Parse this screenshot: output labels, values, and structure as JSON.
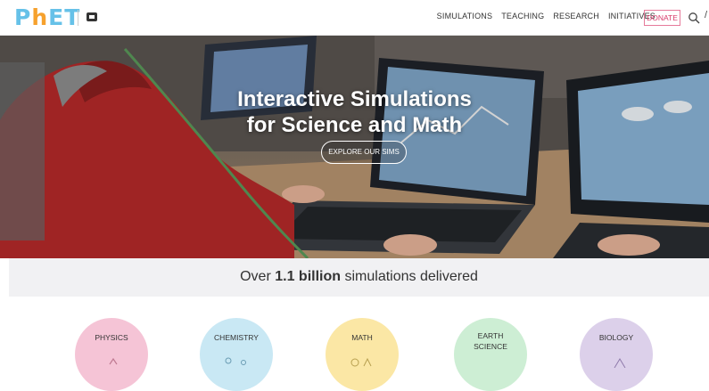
{
  "nav": {
    "logo_letters": [
      "P",
      "h",
      "E",
      "T"
    ],
    "logo_colors": [
      "#66c1e8",
      "#f6a12d",
      "#66c1e8",
      "#66c1e8"
    ],
    "links": [
      "SIMULATIONS",
      "TEACHING",
      "RESEARCH",
      "INITIATIVES"
    ],
    "donate": "DONATE"
  },
  "hero": {
    "title_line1": "Interactive Simulations",
    "title_line2": "for Science and Math",
    "button": "EXPLORE OUR SIMS"
  },
  "stats": {
    "prefix": "Over ",
    "highlight": "1.1 billion",
    "suffix": " simulations delivered"
  },
  "categories": [
    {
      "label": "PHYSICS",
      "color": "#f5c4d6"
    },
    {
      "label": "CHEMISTRY",
      "color": "#c9e8f4"
    },
    {
      "label": "MATH",
      "color": "#fbe7a5"
    },
    {
      "label": "EARTH SCIENCE",
      "color": "#cdeed4"
    },
    {
      "label": "BIOLOGY",
      "color": "#dcd0ea"
    }
  ]
}
